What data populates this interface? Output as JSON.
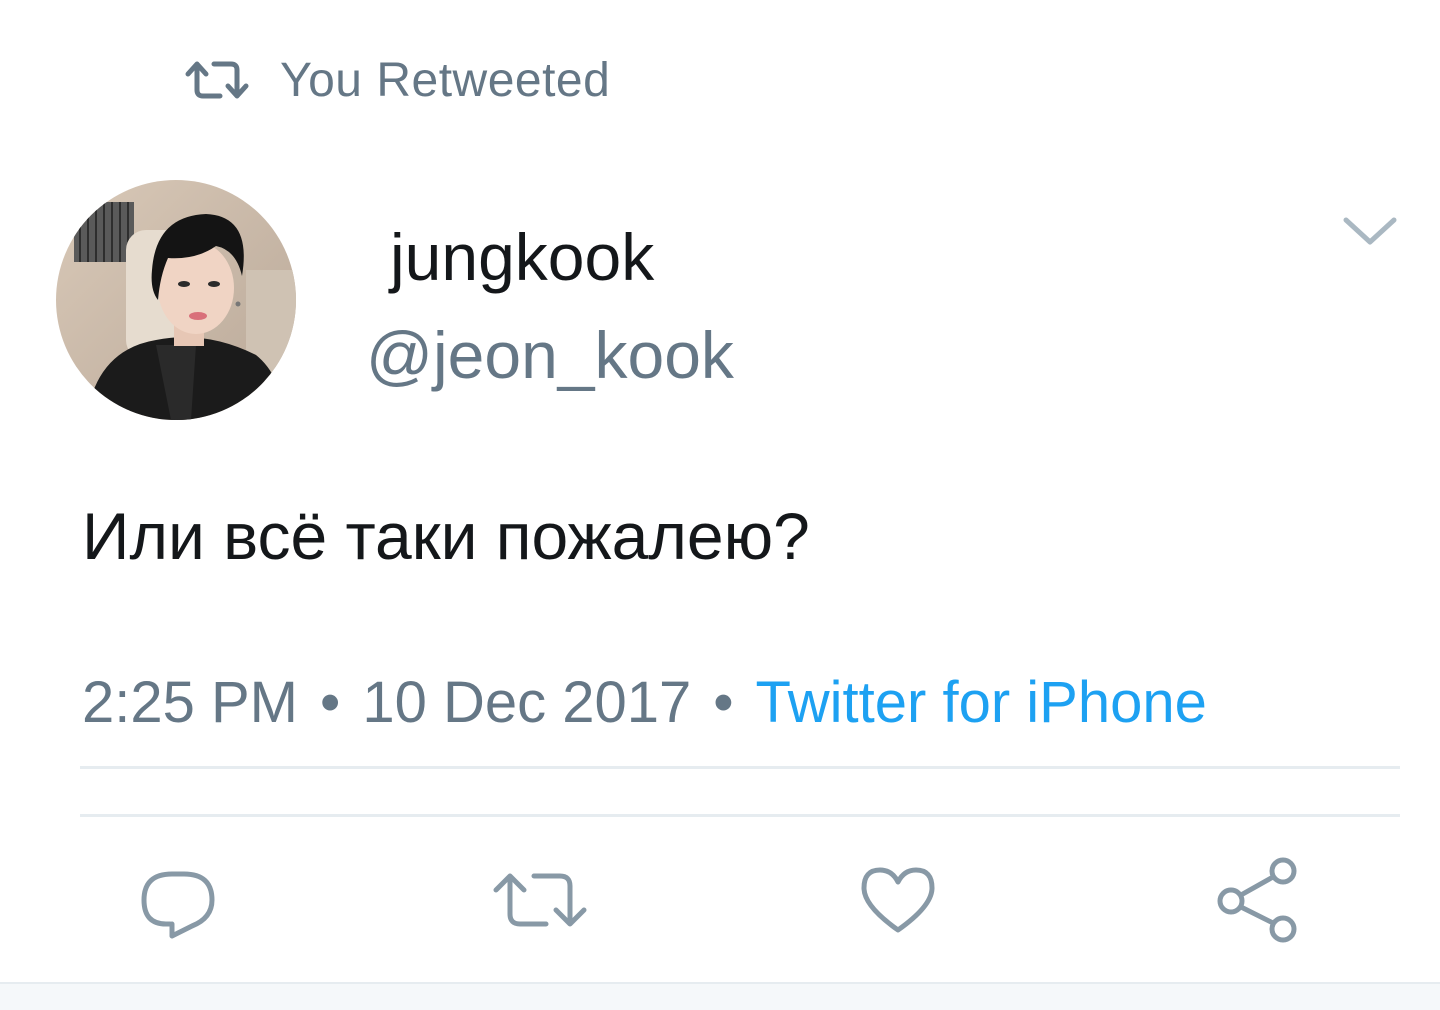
{
  "retweet_context": {
    "icon": "retweet-icon",
    "label": "You Retweeted"
  },
  "author": {
    "display_name": "jungkook",
    "handle": "@jeon_kook",
    "avatar": "profile-photo"
  },
  "tweet": {
    "text": "Или всё таки пожалею?",
    "time": "2:25 PM",
    "date": "10 Dec 2017",
    "separator": "•",
    "source": "Twitter for iPhone"
  },
  "actions": [
    {
      "icon": "reply-icon"
    },
    {
      "icon": "retweet-icon"
    },
    {
      "icon": "like-icon"
    },
    {
      "icon": "share-icon"
    }
  ],
  "colors": {
    "text_primary": "#14171a",
    "text_secondary": "#657786",
    "link": "#1da1f2",
    "divider": "#e6ecf0"
  }
}
